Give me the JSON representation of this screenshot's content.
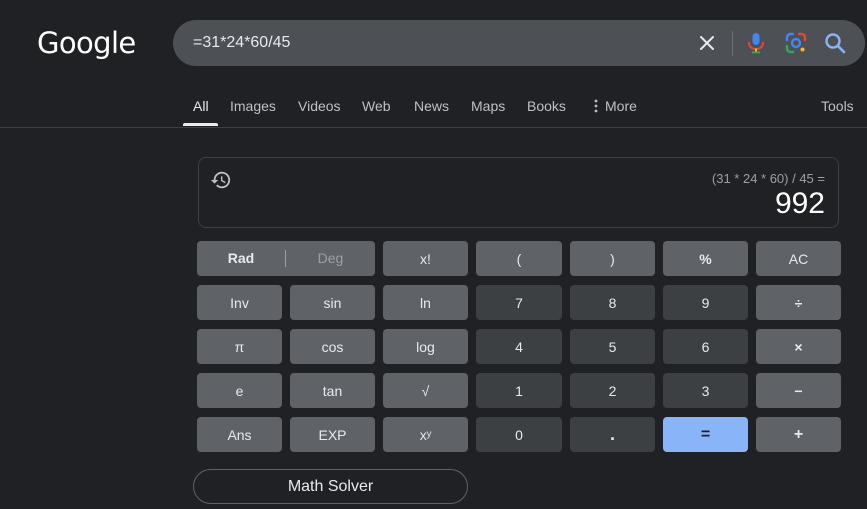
{
  "logo": {
    "text": "Google"
  },
  "search": {
    "query": "=31*24*60/45",
    "icons": [
      "close-icon",
      "microphone-icon",
      "google-lens-icon",
      "search-icon"
    ]
  },
  "tabs": [
    {
      "label": "All",
      "active": true
    },
    {
      "label": "Images"
    },
    {
      "label": "Videos"
    },
    {
      "label": "Web"
    },
    {
      "label": "News"
    },
    {
      "label": "Maps"
    },
    {
      "label": "Books"
    },
    {
      "label": "More",
      "icon": "more-vert-icon"
    },
    {
      "label": "Tools"
    }
  ],
  "calculator": {
    "expression": "(31 * 24 * 60) / 45 =",
    "result": "992",
    "mode": {
      "rad": "Rad",
      "deg": "Deg",
      "selected": "Rad"
    },
    "keys": {
      "fact": "x!",
      "lparen": "(",
      "rparen": ")",
      "percent": "%",
      "ac": "AC",
      "inv": "Inv",
      "sin": "sin",
      "ln": "ln",
      "k7": "7",
      "k8": "8",
      "k9": "9",
      "divide": "÷",
      "pi": "π",
      "cos": "cos",
      "log": "log",
      "k4": "4",
      "k5": "5",
      "k6": "6",
      "multiply": "×",
      "e": "e",
      "tan": "tan",
      "sqrt": "√",
      "k1": "1",
      "k2": "2",
      "k3": "3",
      "minus": "−",
      "ans": "Ans",
      "exp": "EXP",
      "power": "xʸ",
      "k0": "0",
      "dot": ".",
      "equals": "=",
      "plus": "+"
    }
  },
  "math_solver": {
    "label": "Math Solver"
  },
  "colors": {
    "background": "#202124",
    "function_key": "#5f6368",
    "number_key": "#3c4043",
    "equals_key": "#8ab4f8",
    "search_bar": "#4d5156"
  }
}
